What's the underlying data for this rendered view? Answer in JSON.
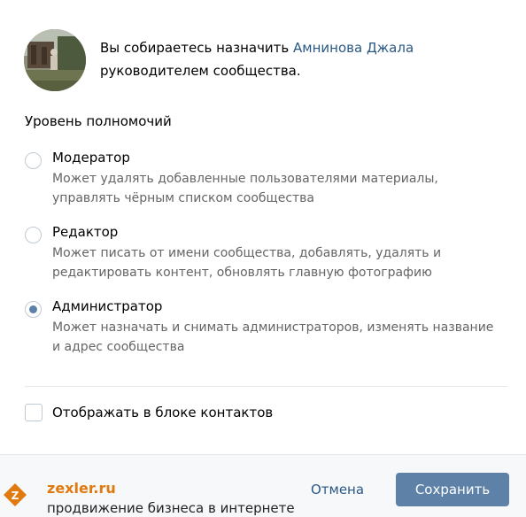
{
  "intro": {
    "text_before": "Вы собираетесь назначить ",
    "user_name": "Амнинова Джала",
    "text_after": "руководителем сообщества."
  },
  "section_title": "Уровень полномочий",
  "options": [
    {
      "label": "Модератор",
      "description": "Может удалять добавленные пользователями материалы, управлять чёрным списком сообщества",
      "checked": false
    },
    {
      "label": "Редактор",
      "description": "Может писать от имени сообщества, добавлять, удалять и редактировать контент, обновлять главную фотографию",
      "checked": false
    },
    {
      "label": "Администратор",
      "description": "Может назначать и снимать администраторов, изменять название и адрес сообщества",
      "checked": true
    }
  ],
  "contacts_checkbox": {
    "label": "Отображать в блоке контактов",
    "checked": false
  },
  "footer": {
    "cancel_label": "Отмена",
    "save_label": "Сохранить"
  },
  "watermark": {
    "logo_letter": "Z",
    "site": "zexler.ru",
    "tagline": "продвижение бизнеса в интернете"
  },
  "colors": {
    "link": "#2a5885",
    "primary_button": "#5e81a8",
    "secondary_text": "#656565",
    "watermark_orange": "#e07a0e"
  }
}
